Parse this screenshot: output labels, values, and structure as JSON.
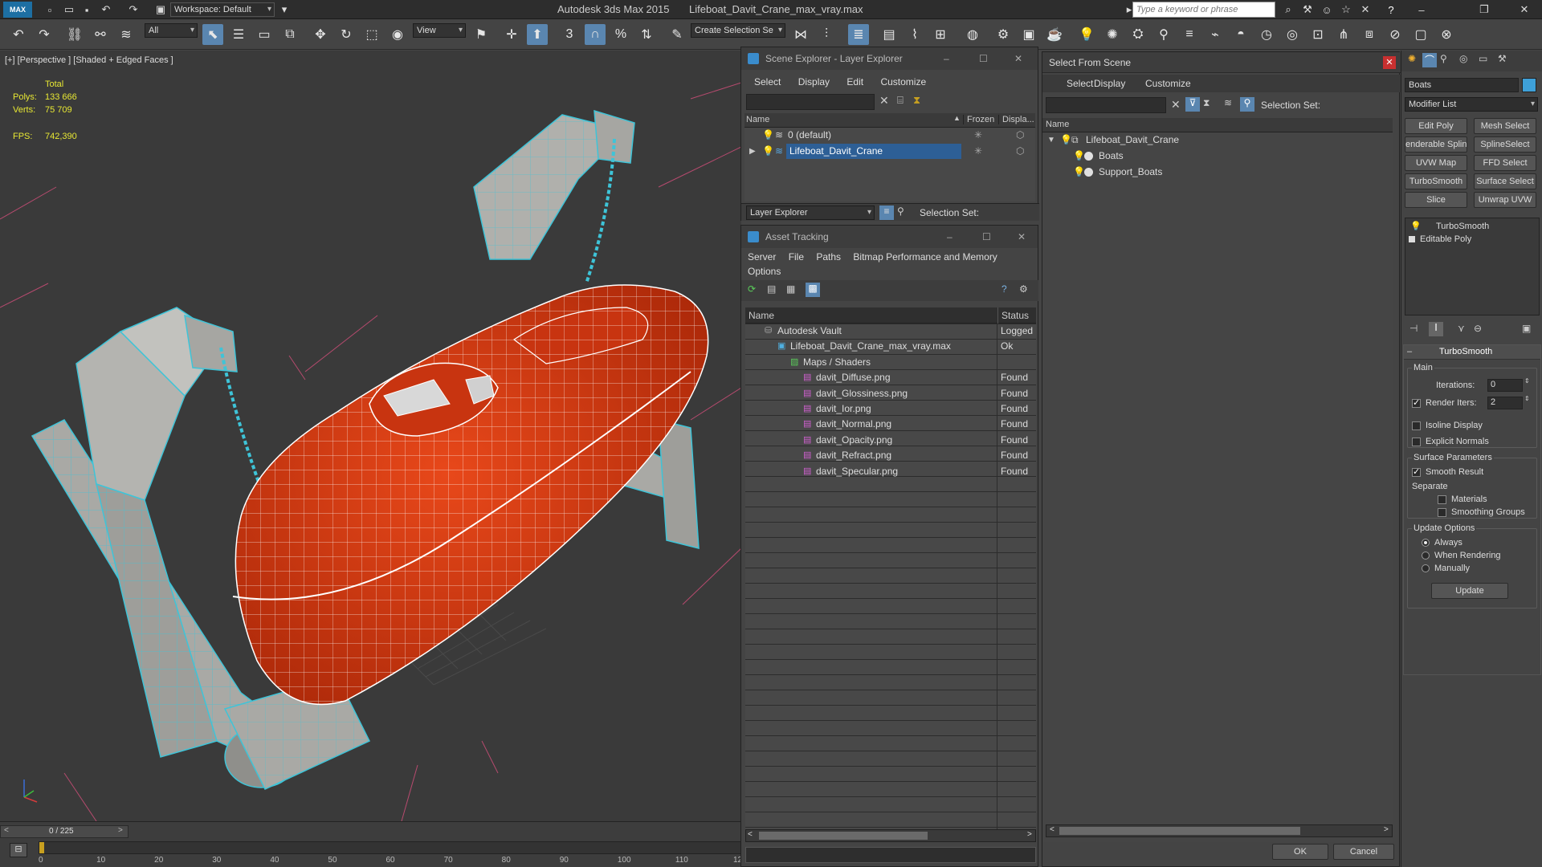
{
  "titlebar": {
    "workspace": "Workspace: Default",
    "app_title": "Autodesk 3ds Max  2015",
    "file_title": "Lifeboat_Davit_Crane_max_vray.max",
    "search_placeholder": "Type a keyword or phrase"
  },
  "toolbar": {
    "filter_value": "All",
    "ref_coord_value": "View",
    "selection_set_value": "Create Selection Se"
  },
  "viewport": {
    "label": "[+] [Perspective ] [Shaded + Edged Faces ]",
    "stats": {
      "total_label": "Total",
      "polys_label": "Polys:",
      "polys_value": "133 666",
      "verts_label": "Verts:",
      "verts_value": "75 709",
      "fps_label": "FPS:",
      "fps_value": "742,390"
    }
  },
  "timeline": {
    "frame_counter": "0 / 225",
    "ticks": [
      "0",
      "10",
      "20",
      "30",
      "40",
      "50",
      "60",
      "70",
      "80",
      "90",
      "100",
      "110",
      "12"
    ]
  },
  "scene_explorer": {
    "title": "Scene Explorer - Layer Explorer",
    "menu": [
      "Select",
      "Display",
      "Edit",
      "Customize"
    ],
    "columns": {
      "name": "Name",
      "frozen": "Frozen",
      "display": "Displa..."
    },
    "rows": [
      {
        "name": "0 (default)"
      },
      {
        "name": "Lifeboat_Davit_Crane"
      }
    ],
    "footer_dropdown": "Layer Explorer",
    "footer_selection_set": "Selection Set:"
  },
  "asset_tracking": {
    "title": "Asset Tracking",
    "menu": [
      "Server",
      "File",
      "Paths",
      "Bitmap Performance and Memory"
    ],
    "menu2": "Options",
    "columns": {
      "name": "Name",
      "status": "Status"
    },
    "rows": [
      {
        "name": "Autodesk Vault",
        "status": "Logged"
      },
      {
        "name": "Lifeboat_Davit_Crane_max_vray.max",
        "status": "Ok"
      },
      {
        "name": "Maps / Shaders",
        "status": ""
      },
      {
        "name": "davit_Diffuse.png",
        "status": "Found"
      },
      {
        "name": "davit_Glossiness.png",
        "status": "Found"
      },
      {
        "name": "davit_Ior.png",
        "status": "Found"
      },
      {
        "name": "davit_Normal.png",
        "status": "Found"
      },
      {
        "name": "davit_Opacity.png",
        "status": "Found"
      },
      {
        "name": "davit_Refract.png",
        "status": "Found"
      },
      {
        "name": "davit_Specular.png",
        "status": "Found"
      }
    ]
  },
  "select_from_scene": {
    "title": "Select From Scene",
    "menu": [
      "Select",
      "Display",
      "Customize"
    ],
    "selection_set": "Selection Set:",
    "col_name": "Name",
    "tree": [
      {
        "name": "Lifeboat_Davit_Crane"
      },
      {
        "name": "Boats"
      },
      {
        "name": "Support_Boats"
      }
    ],
    "ok": "OK",
    "cancel": "Cancel"
  },
  "command_panel": {
    "object_name": "Boats",
    "modifier_list": "Modifier List",
    "mod_buttons": [
      "Edit Poly",
      "Mesh Select",
      "enderable Splin",
      "SplineSelect",
      "UVW Map",
      "FFD Select",
      "TurboSmooth",
      "Surface Select",
      "Slice",
      "Unwrap UVW"
    ],
    "stack": [
      "TurboSmooth",
      "Editable Poly"
    ],
    "rollout_title": "TurboSmooth",
    "main_label": "Main",
    "iterations_label": "Iterations:",
    "iterations_value": "0",
    "render_iters_label": "Render Iters:",
    "render_iters_value": "2",
    "isoline_label": "Isoline Display",
    "explicit_normals_label": "Explicit Normals",
    "surface_params_label": "Surface Parameters",
    "smooth_result_label": "Smooth Result",
    "separate_label": "Separate",
    "materials_label": "Materials",
    "smoothing_groups_label": "Smoothing Groups",
    "update_options_label": "Update Options",
    "always_label": "Always",
    "when_rendering_label": "When Rendering",
    "manually_label": "Manually",
    "update_button": "Update"
  },
  "colors": {
    "accent": "#5a86b0",
    "hull": "#d73a12",
    "wire_blue": "#3ec4d8",
    "stat_yellow": "#e8e833"
  }
}
